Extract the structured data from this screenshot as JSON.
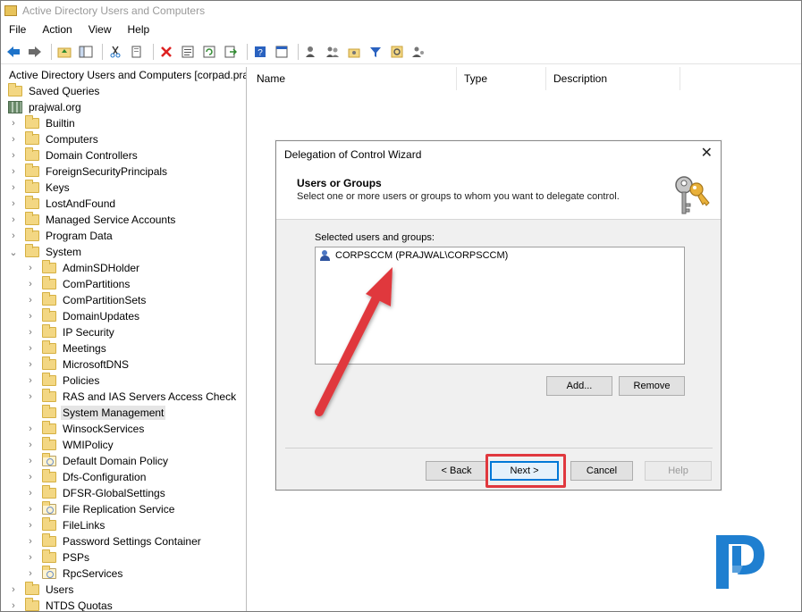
{
  "window": {
    "title": "Active Directory Users and Computers"
  },
  "menu": [
    "File",
    "Action",
    "View",
    "Help"
  ],
  "toolbar": {
    "icons": [
      "back-arrow-icon",
      "forward-arrow-icon",
      "up-folder-icon",
      "show-hide-console-tree-icon",
      "cut-icon",
      "copy-icon",
      "delete-icon",
      "properties-icon",
      "refresh-icon",
      "export-list-icon",
      "help-icon",
      "view-icon",
      "create-user-icon",
      "create-group-icon",
      "create-ou-icon",
      "filter-icon",
      "find-icon",
      "add-to-group-icon"
    ]
  },
  "tree": {
    "root": "Active Directory Users and Computers [corpad.pra",
    "items": [
      {
        "label": "Saved Queries",
        "level": 1,
        "expander": "",
        "icon": "folder"
      },
      {
        "label": "prajwal.org",
        "level": 1,
        "expander": "",
        "icon": "domain"
      },
      {
        "label": "Builtin",
        "level": 2,
        "expander": "›",
        "icon": "folder"
      },
      {
        "label": "Computers",
        "level": 2,
        "expander": "›",
        "icon": "folder"
      },
      {
        "label": "Domain Controllers",
        "level": 2,
        "expander": "›",
        "icon": "folder"
      },
      {
        "label": "ForeignSecurityPrincipals",
        "level": 2,
        "expander": "›",
        "icon": "folder"
      },
      {
        "label": "Keys",
        "level": 2,
        "expander": "›",
        "icon": "folder"
      },
      {
        "label": "LostAndFound",
        "level": 2,
        "expander": "›",
        "icon": "folder"
      },
      {
        "label": "Managed Service Accounts",
        "level": 2,
        "expander": "›",
        "icon": "folder"
      },
      {
        "label": "Program Data",
        "level": 2,
        "expander": "›",
        "icon": "folder"
      },
      {
        "label": "System",
        "level": 2,
        "expander": "⌄",
        "icon": "folder"
      },
      {
        "label": "AdminSDHolder",
        "level": 3,
        "expander": "›",
        "icon": "folder"
      },
      {
        "label": "ComPartitions",
        "level": 3,
        "expander": "›",
        "icon": "folder"
      },
      {
        "label": "ComPartitionSets",
        "level": 3,
        "expander": "›",
        "icon": "folder"
      },
      {
        "label": "DomainUpdates",
        "level": 3,
        "expander": "›",
        "icon": "folder"
      },
      {
        "label": "IP Security",
        "level": 3,
        "expander": "›",
        "icon": "folder"
      },
      {
        "label": "Meetings",
        "level": 3,
        "expander": "›",
        "icon": "folder"
      },
      {
        "label": "MicrosoftDNS",
        "level": 3,
        "expander": "›",
        "icon": "folder"
      },
      {
        "label": "Policies",
        "level": 3,
        "expander": "›",
        "icon": "folder"
      },
      {
        "label": "RAS and IAS Servers Access Check",
        "level": 3,
        "expander": "›",
        "icon": "folder"
      },
      {
        "label": "System Management",
        "level": 3,
        "expander": "",
        "icon": "folder",
        "selected": true
      },
      {
        "label": "WinsockServices",
        "level": 3,
        "expander": "›",
        "icon": "folder"
      },
      {
        "label": "WMIPolicy",
        "level": 3,
        "expander": "›",
        "icon": "folder"
      },
      {
        "label": "Default Domain Policy",
        "level": 3,
        "expander": "›",
        "icon": "object"
      },
      {
        "label": "Dfs-Configuration",
        "level": 3,
        "expander": "›",
        "icon": "folder"
      },
      {
        "label": "DFSR-GlobalSettings",
        "level": 3,
        "expander": "›",
        "icon": "folder"
      },
      {
        "label": "File Replication Service",
        "level": 3,
        "expander": "›",
        "icon": "object"
      },
      {
        "label": "FileLinks",
        "level": 3,
        "expander": "›",
        "icon": "folder"
      },
      {
        "label": "Password Settings Container",
        "level": 3,
        "expander": "›",
        "icon": "folder"
      },
      {
        "label": "PSPs",
        "level": 3,
        "expander": "›",
        "icon": "folder"
      },
      {
        "label": "RpcServices",
        "level": 3,
        "expander": "›",
        "icon": "object"
      },
      {
        "label": "Users",
        "level": 2,
        "expander": "›",
        "icon": "folder"
      },
      {
        "label": "NTDS Quotas",
        "level": 2,
        "expander": "›",
        "icon": "folder"
      }
    ]
  },
  "list": {
    "columns": [
      "Name",
      "Type",
      "Description"
    ]
  },
  "dialog": {
    "title": "Delegation of Control Wizard",
    "close": "✕",
    "heading": "Users or Groups",
    "subheading": "Select one or more users or groups to whom you want to delegate control.",
    "selected_label": "Selected users and groups:",
    "selected_items": [
      "CORPSCCM (PRAJWAL\\CORPSCCM)"
    ],
    "buttons": {
      "add": "Add...",
      "remove": "Remove",
      "back": "< Back",
      "next": "Next >",
      "cancel": "Cancel",
      "help": "Help"
    },
    "help_disabled": true
  },
  "annotation": {
    "arrow_color": "#e0383e",
    "highlight_color": "#e0383e"
  },
  "logo": {
    "letter": "P",
    "color": "#1f7fd0"
  }
}
